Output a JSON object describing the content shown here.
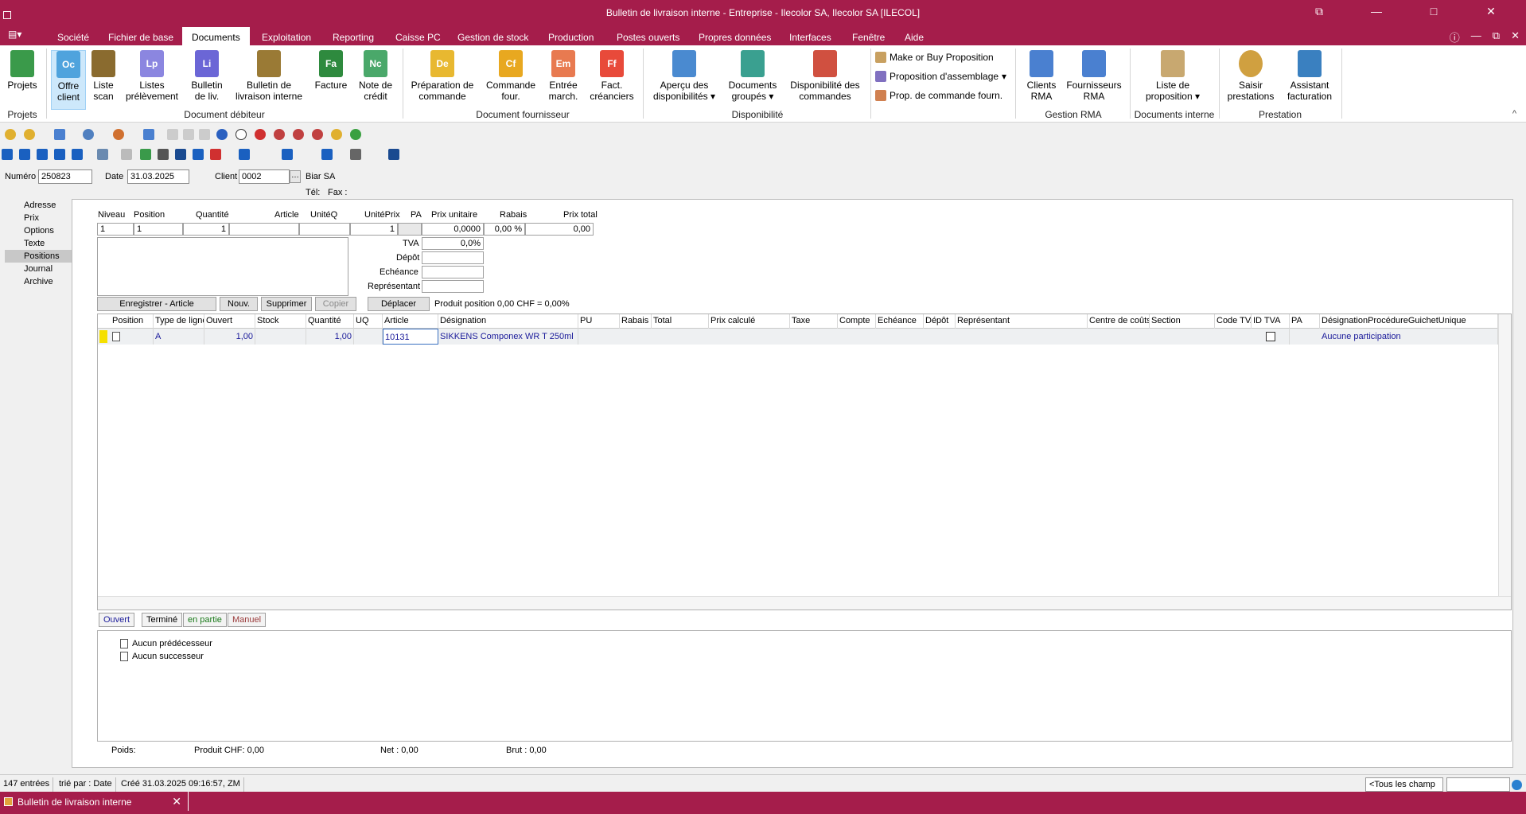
{
  "window": {
    "title": "Bulletin de livraison interne - Entreprise - Ilecolor SA, Ilecolor SA [ILECOL]",
    "buttons": {
      "restore_icon": "⧉",
      "minimize_icon": "—",
      "maximize_icon": "□",
      "close_icon": "✕"
    }
  },
  "menu": {
    "items": [
      "Société",
      "Fichier de base",
      "Documents",
      "Exploitation",
      "Reporting",
      "Caisse PC",
      "Gestion de stock",
      "Production",
      "Postes ouverts",
      "Propres données",
      "Interfaces",
      "Fenêtre",
      "Aide"
    ],
    "active": "Documents"
  },
  "ribbon": {
    "projets": {
      "label": "Projets",
      "group": "Projets"
    },
    "debiteur": {
      "group": "Document débiteur",
      "buttons": [
        {
          "label": "Offre client",
          "abbr": "Oc",
          "color": "#4fa3dd"
        },
        {
          "label": "Liste scan",
          "abbr": "",
          "color": "#8a6b2f"
        },
        {
          "label": "Listes prélèvement",
          "abbr": "Lp",
          "color": "#8b86e0"
        },
        {
          "label": "Bulletin de liv.",
          "abbr": "Li",
          "color": "#6b66d6"
        },
        {
          "label": "Bulletin de livraison interne",
          "abbr": "",
          "color": "#9a7a35"
        },
        {
          "label": "Facture",
          "abbr": "Fa",
          "color": "#2e8a3e"
        },
        {
          "label": "Note de crédit",
          "abbr": "Nc",
          "color": "#4aa86a"
        }
      ]
    },
    "fournisseur": {
      "group": "Document fournisseur",
      "buttons": [
        {
          "label": "Préparation de commande",
          "abbr": "De",
          "color": "#e8b830"
        },
        {
          "label": "Commande four.",
          "abbr": "Cf",
          "color": "#e8a820"
        },
        {
          "label": "Entrée march.",
          "abbr": "Em",
          "color": "#e87a50"
        },
        {
          "label": "Fact. créanciers",
          "abbr": "Ff",
          "color": "#e84a3a"
        }
      ]
    },
    "disponibilite": {
      "group": "Disponibilité",
      "buttons": [
        {
          "label": "Aperçu des disponibilités",
          "abbr": "",
          "color": "#4a8ad0"
        },
        {
          "label": "Documents groupés",
          "abbr": "",
          "color": "#3aa090"
        },
        {
          "label": "Disponibilité des commandes",
          "abbr": "",
          "color": "#d05040"
        }
      ]
    },
    "misc": [
      {
        "label": "Make or Buy Proposition",
        "color": "#c8a060"
      },
      {
        "label": "Proposition d'assemblage",
        "color": "#8070c0"
      },
      {
        "label": "Prop. de commande fourn.",
        "color": "#d08050"
      }
    ],
    "rma": {
      "group": "Gestion RMA",
      "buttons": [
        {
          "label": "Clients RMA",
          "color": "#4a80d0"
        },
        {
          "label": "Fournisseurs RMA",
          "color": "#4a80d0"
        }
      ]
    },
    "interne": {
      "group": "Documents interne",
      "button": "Liste de proposition"
    },
    "prestation": {
      "group": "Prestation",
      "buttons": [
        {
          "label": "Saisir prestations",
          "color": "#d0a040"
        },
        {
          "label": "Assistant facturation",
          "color": "#3a80c0"
        }
      ]
    },
    "collapse_icon": "^"
  },
  "header": {
    "numero_label": "Numéro",
    "numero": "250823",
    "date_label": "Date",
    "date": "31.03.2025",
    "client_label": "Client",
    "client": "0002",
    "client_name": "Biar SA",
    "tel_label": "Tél:",
    "fax_label": "Fax :"
  },
  "leftnav": {
    "items": [
      "Adresse",
      "Prix",
      "Options",
      "Texte",
      "Positions",
      "Journal",
      "Archive"
    ],
    "active": "Positions"
  },
  "position_form": {
    "labels": {
      "niveau": "Niveau",
      "position": "Position",
      "quantite": "Quantité",
      "article": "Article",
      "uniteq": "UnitéQ",
      "uniteprix": "UnitéPrix",
      "pa": "PA",
      "prix_unitaire": "Prix unitaire",
      "rabais": "Rabais",
      "prix_total": "Prix total",
      "tva": "TVA",
      "depot": "Dépôt",
      "echeance": "Echéance",
      "representant": "Représentant"
    },
    "values": {
      "niveau": "1",
      "position": "1",
      "quantite": "1",
      "uniteprix": "1",
      "prix_unitaire": "0,0000",
      "rabais": "0,00 %",
      "prix_total": "0,00",
      "tva": "0,0%"
    }
  },
  "actions": {
    "enregistrer": "Enregistrer - Article",
    "nouv": "Nouv.",
    "supprimer": "Supprimer",
    "copier": "Copier",
    "deplacer": "Déplacer",
    "produit_position": "Produit position  0,00 CHF = 0,00%"
  },
  "grid": {
    "columns": [
      "Position",
      "Type de ligne",
      "Ouvert",
      "Stock",
      "Quantité",
      "UQ",
      "Article",
      "Désignation",
      "PU",
      "Rabais",
      "Total",
      "Prix calculé",
      "Taxe",
      "Compte",
      "Echéance",
      "Dépôt",
      "Représentant",
      "Centre de coûts",
      "Section",
      "Code TVA",
      "ID TVA",
      "PA",
      "DésignationProcédureGuichetUnique"
    ],
    "row": {
      "type": "A",
      "ouvert": "1,00",
      "quantite": "1,00",
      "article": "10131",
      "designation": "SIKKENS Componex WR T 250ml",
      "procedure": "Aucune participation"
    }
  },
  "status_filters": [
    {
      "label": "Ouvert",
      "color": "#1a1a9a"
    },
    {
      "label": "Terminé",
      "color": "#000000"
    },
    {
      "label": "en partie",
      "color": "#1a7a1a"
    },
    {
      "label": "Manuel",
      "color": "#9a3a3a"
    }
  ],
  "relations": {
    "predecessor": "Aucun prédécesseur",
    "successor": "Aucun successeur"
  },
  "totals": {
    "poids": "Poids:",
    "produit": "Produit CHF: 0,00",
    "net": "Net  : 0,00",
    "brut": "Brut  : 0,00"
  },
  "statusbar": {
    "entries": "147 entrées",
    "sort": "trié par : Date",
    "created": "Créé 31.03.2025 09:16:57, ZM",
    "filter": "<Tous les champ"
  },
  "taskbar": {
    "task": "Bulletin de livraison interne"
  }
}
